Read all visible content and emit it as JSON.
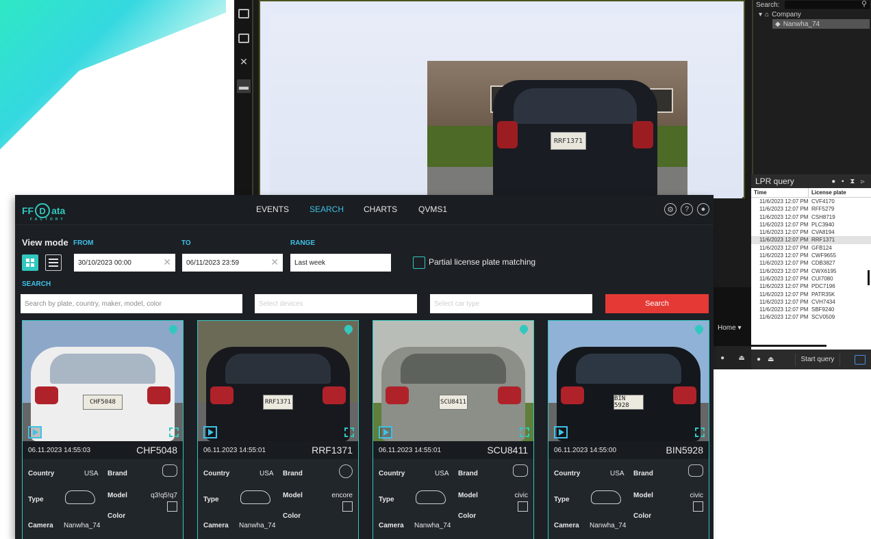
{
  "vms": {
    "search_label": "Search:",
    "tree": {
      "root": "Company",
      "device": "Nanwha_74"
    },
    "home_label": "Home",
    "lpr": {
      "title": "LPR query",
      "col_time": "Time",
      "col_plate": "License plate",
      "rows": [
        {
          "time": "11/6/2023 12:07 PM",
          "plate": "CVF4170"
        },
        {
          "time": "11/6/2023 12:07 PM",
          "plate": "RFF5279"
        },
        {
          "time": "11/6/2023 12:07 PM",
          "plate": "CSH8719"
        },
        {
          "time": "11/6/2023 12:07 PM",
          "plate": "PLC3940"
        },
        {
          "time": "11/6/2023 12:07 PM",
          "plate": "CVA8194"
        },
        {
          "time": "11/6/2023 12:07 PM",
          "plate": "RRF1371"
        },
        {
          "time": "11/6/2023 12:07 PM",
          "plate": "GFB124"
        },
        {
          "time": "11/6/2023 12:07 PM",
          "plate": "CWF9655"
        },
        {
          "time": "11/6/2023 12:07 PM",
          "plate": "CDB3827"
        },
        {
          "time": "11/6/2023 12:07 PM",
          "plate": "CWX6195"
        },
        {
          "time": "11/6/2023 12:07 PM",
          "plate": "CUI7080"
        },
        {
          "time": "11/6/2023 12:07 PM",
          "plate": "PDC7196"
        },
        {
          "time": "11/6/2023 12:07 PM",
          "plate": "PATR35K"
        },
        {
          "time": "11/6/2023 12:07 PM",
          "plate": "CVH7434"
        },
        {
          "time": "11/6/2023 12:07 PM",
          "plate": "SBF9240"
        },
        {
          "time": "11/6/2023 12:07 PM",
          "plate": "SCV0509"
        }
      ],
      "start_query": "Start query"
    },
    "video_plate": "RRF1371"
  },
  "app": {
    "logo": {
      "prefix": "FF",
      "d": "D",
      "suffix": "ata",
      "sub": "FACTORY"
    },
    "nav": {
      "events": "EVENTS",
      "search": "SEARCH",
      "charts": "CHARTS",
      "qvms": "QVMS1"
    },
    "view_mode": "View mode",
    "from_label": "FROM",
    "to_label": "TO",
    "range_label": "RANGE",
    "from_value": "30/10/2023 00:00",
    "to_value": "06/11/2023 23:59",
    "range_value": "Last week",
    "partial_label": "Partial license plate matching",
    "search_label": "SEARCH",
    "search_placeholder": "Search by plate, country, maker, model, color",
    "devices_placeholder": "Select devices",
    "cartype_placeholder": "Select car type",
    "search_button": "Search",
    "field_labels": {
      "country": "Country",
      "brand": "Brand",
      "type": "Type",
      "model": "Model",
      "color": "Color",
      "camera": "Camera"
    },
    "cards": [
      {
        "timestamp": "06.11.2023 14:55:03",
        "plate": "CHF5048",
        "country": "USA",
        "model": "q3!q5!q7",
        "camera": "Nanwha_74",
        "brand_icon": "audi-logo-icon"
      },
      {
        "timestamp": "06.11.2023 14:55:01",
        "plate": "RRF1371",
        "country": "USA",
        "model": "encore",
        "camera": "Nanwha_74",
        "brand_icon": "buick-logo-icon"
      },
      {
        "timestamp": "06.11.2023 14:55:01",
        "plate": "SCU8411",
        "country": "USA",
        "model": "civic",
        "camera": "Nanwha_74",
        "brand_icon": "honda-logo-icon"
      },
      {
        "timestamp": "06.11.2023 14:55:00",
        "plate": "BIN5928",
        "country": "USA",
        "model": "civic",
        "camera": "Nanwha_74",
        "brand_icon": "honda-logo-icon"
      }
    ],
    "card_plate_images": [
      "CHF5048",
      "RRF1371",
      "SCU8411",
      "BIN 5928"
    ]
  }
}
